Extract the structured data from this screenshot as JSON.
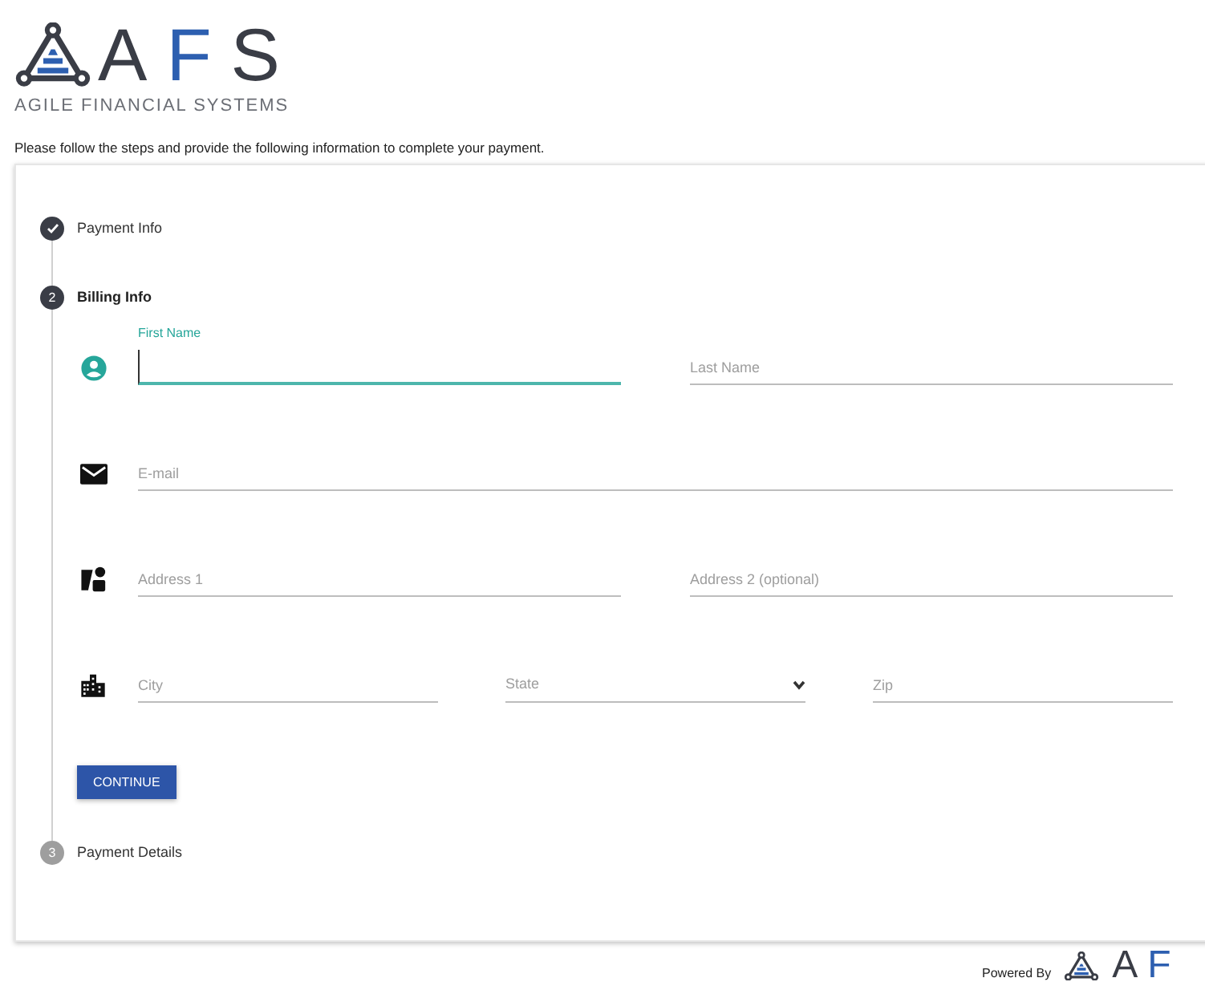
{
  "logo": {
    "letters": [
      {
        "char": "A",
        "accent": false
      },
      {
        "char": "F",
        "accent": true
      },
      {
        "char": "S",
        "accent": false
      }
    ],
    "tagline": "AGILE FINANCIAL SYSTEMS"
  },
  "intro": "Please follow the steps and provide the following information to complete your payment.",
  "steps": [
    {
      "completed": true,
      "selected": false,
      "label": "Payment Info"
    },
    {
      "completed": false,
      "selected": true,
      "number": "2",
      "label": "Billing Info"
    },
    {
      "completed": false,
      "selected": false,
      "number": "3",
      "label": "Payment Details"
    }
  ],
  "billing_form": {
    "rows": [
      {
        "kind": "person",
        "fields": [
          {
            "kind": "text",
            "label": "First Name",
            "focused": true
          },
          {
            "kind": "text",
            "placeholder": "Last Name",
            "focused": false
          }
        ]
      },
      {
        "kind": "mail",
        "fields": [
          {
            "kind": "text",
            "placeholder": "E-mail",
            "focused": false
          }
        ]
      },
      {
        "kind": "address",
        "fields": [
          {
            "kind": "text",
            "placeholder": "Address 1",
            "focused": false
          },
          {
            "kind": "text",
            "placeholder": "Address 2 (optional)",
            "focused": false
          }
        ]
      },
      {
        "kind": "city",
        "fields": [
          {
            "kind": "text",
            "placeholder": "City",
            "focused": false
          },
          {
            "kind": "select",
            "placeholder": "State",
            "focused": false
          },
          {
            "kind": "text",
            "placeholder": "Zip",
            "focused": false
          }
        ]
      }
    ],
    "continue_button": "CONTINUE"
  },
  "footer": {
    "powered_by": "Powered By",
    "logo_letters": [
      {
        "char": "A",
        "accent": false
      },
      {
        "char": "F",
        "accent": true
      }
    ]
  }
}
